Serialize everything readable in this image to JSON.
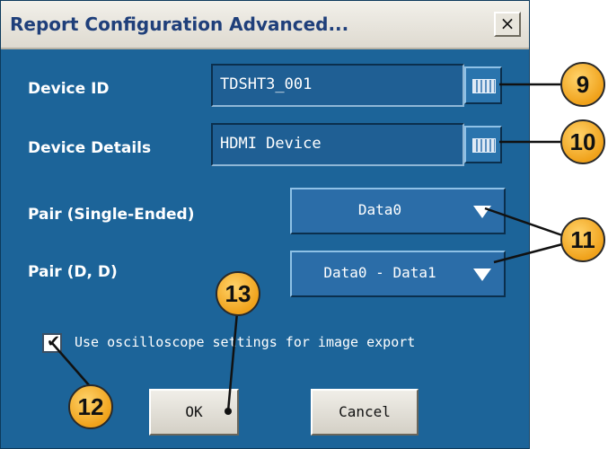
{
  "dialog": {
    "title": "Report Configuration Advanced...",
    "close_label": "×",
    "device_id_label": "Device ID",
    "device_id_value": "TDSHT3_001",
    "device_details_label": "Device Details",
    "device_details_value": "HDMI Device",
    "pair_single_label": "Pair (Single-Ended)",
    "pair_single_value": "Data0",
    "pair_diff_label": "Pair (D, D)",
    "pair_diff_value": "Data0 - Data1",
    "use_scope_settings_label": "Use oscilloscope settings for image export",
    "use_scope_settings_checked": true,
    "ok_label": "OK",
    "cancel_label": "Cancel"
  },
  "callouts": [
    "9",
    "10",
    "11",
    "12",
    "13"
  ],
  "colors": {
    "dialog_bg": "#1c6499",
    "callout_fill": "#f0a21b"
  }
}
